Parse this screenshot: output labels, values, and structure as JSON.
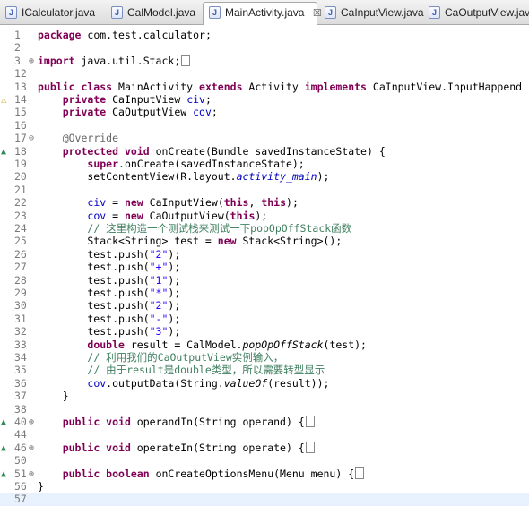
{
  "tabs": [
    {
      "label": "ICalculator.java",
      "active": false
    },
    {
      "label": "CalModel.java",
      "active": false
    },
    {
      "label": "MainActivity.java",
      "active": true,
      "close": "☒"
    },
    {
      "label": "CaInputView.java",
      "active": false
    },
    {
      "label": "CaOutputView.java",
      "active": false
    }
  ],
  "lines": [
    {
      "n": "1",
      "parts": [
        [
          "kw",
          "package"
        ],
        [
          "",
          "com.test.calculator;"
        ]
      ]
    },
    {
      "n": "2",
      "parts": []
    },
    {
      "n": "3",
      "fold": "⊕",
      "parts": [
        [
          "kw",
          "import"
        ],
        [
          "",
          "java.util.Stack;"
        ]
      ],
      "box": true
    },
    {
      "n": "12",
      "parts": []
    },
    {
      "n": "13",
      "parts": [
        [
          "kw",
          "public class"
        ],
        [
          "",
          " MainActivity "
        ],
        [
          "kw",
          "extends"
        ],
        [
          "",
          " Activity "
        ],
        [
          "kw",
          "implements"
        ],
        [
          "",
          " CaInputView.InputHappend {"
        ]
      ]
    },
    {
      "n": "14",
      "mark": "warn",
      "parts": [
        [
          "",
          "    "
        ],
        [
          "kw",
          "private"
        ],
        [
          "",
          " CaInputView "
        ],
        [
          "fld",
          "civ"
        ],
        [
          "",
          ";"
        ]
      ]
    },
    {
      "n": "15",
      "parts": [
        [
          "",
          "    "
        ],
        [
          "kw",
          "private"
        ],
        [
          "",
          " CaOutputView "
        ],
        [
          "fld",
          "cov"
        ],
        [
          "",
          ";"
        ]
      ]
    },
    {
      "n": "16",
      "parts": []
    },
    {
      "n": "17",
      "fold": "⊖",
      "parts": [
        [
          "",
          "    "
        ],
        [
          "ann",
          "@Override"
        ]
      ]
    },
    {
      "n": "18",
      "mark": "override",
      "parts": [
        [
          "",
          "    "
        ],
        [
          "kw",
          "protected void"
        ],
        [
          "",
          " onCreate(Bundle savedInstanceState) {"
        ]
      ]
    },
    {
      "n": "19",
      "parts": [
        [
          "",
          "        "
        ],
        [
          "kw",
          "super"
        ],
        [
          "",
          ".onCreate(savedInstanceState);"
        ]
      ]
    },
    {
      "n": "20",
      "parts": [
        [
          "",
          "        setContentView(R.layout."
        ],
        [
          "ifld",
          "activity_main"
        ],
        [
          "",
          ");"
        ]
      ]
    },
    {
      "n": "21",
      "parts": []
    },
    {
      "n": "22",
      "parts": [
        [
          "",
          "        "
        ],
        [
          "fld",
          "civ"
        ],
        [
          "",
          " = "
        ],
        [
          "kw",
          "new"
        ],
        [
          "",
          " CaInputView("
        ],
        [
          "kw",
          "this"
        ],
        [
          "",
          ", "
        ],
        [
          "kw",
          "this"
        ],
        [
          "",
          ");"
        ]
      ]
    },
    {
      "n": "23",
      "parts": [
        [
          "",
          "        "
        ],
        [
          "fld",
          "cov"
        ],
        [
          "",
          " = "
        ],
        [
          "kw",
          "new"
        ],
        [
          "",
          " CaOutputView("
        ],
        [
          "kw",
          "this"
        ],
        [
          "",
          ");"
        ]
      ]
    },
    {
      "n": "24",
      "parts": [
        [
          "",
          "        "
        ],
        [
          "cmt",
          "// 这里构造一个测试栈来测试一下popOpOffStack函数"
        ]
      ]
    },
    {
      "n": "25",
      "parts": [
        [
          "",
          "        Stack<String> test = "
        ],
        [
          "kw",
          "new"
        ],
        [
          "",
          " Stack<String>();"
        ]
      ]
    },
    {
      "n": "26",
      "parts": [
        [
          "",
          "        test.push("
        ],
        [
          "str",
          "\"2\""
        ],
        [
          "",
          ");"
        ]
      ]
    },
    {
      "n": "27",
      "parts": [
        [
          "",
          "        test.push("
        ],
        [
          "str",
          "\"+\""
        ],
        [
          "",
          ");"
        ]
      ]
    },
    {
      "n": "28",
      "parts": [
        [
          "",
          "        test.push("
        ],
        [
          "str",
          "\"1\""
        ],
        [
          "",
          ");"
        ]
      ]
    },
    {
      "n": "29",
      "parts": [
        [
          "",
          "        test.push("
        ],
        [
          "str",
          "\"*\""
        ],
        [
          "",
          ");"
        ]
      ]
    },
    {
      "n": "30",
      "parts": [
        [
          "",
          "        test.push("
        ],
        [
          "str",
          "\"2\""
        ],
        [
          "",
          ");"
        ]
      ]
    },
    {
      "n": "31",
      "parts": [
        [
          "",
          "        test.push("
        ],
        [
          "str",
          "\"-\""
        ],
        [
          "",
          ");"
        ]
      ]
    },
    {
      "n": "32",
      "parts": [
        [
          "",
          "        test.push("
        ],
        [
          "str",
          "\"3\""
        ],
        [
          "",
          ");"
        ]
      ]
    },
    {
      "n": "33",
      "parts": [
        [
          "",
          "        "
        ],
        [
          "kw",
          "double"
        ],
        [
          "",
          " result = CalModel."
        ],
        [
          "ital",
          "popOpOffStack"
        ],
        [
          "",
          "(test);"
        ]
      ]
    },
    {
      "n": "34",
      "parts": [
        [
          "",
          "        "
        ],
        [
          "cmt",
          "// 利用我们的CaOutputView实例输入，"
        ]
      ]
    },
    {
      "n": "35",
      "parts": [
        [
          "",
          "        "
        ],
        [
          "cmt",
          "// 由于result是double类型，所以需要转型显示"
        ]
      ]
    },
    {
      "n": "36",
      "parts": [
        [
          "",
          "        "
        ],
        [
          "fld",
          "cov"
        ],
        [
          "",
          ".outputData(String."
        ],
        [
          "ital",
          "valueOf"
        ],
        [
          "",
          "(result));"
        ]
      ]
    },
    {
      "n": "37",
      "parts": [
        [
          "",
          "    }"
        ]
      ]
    },
    {
      "n": "38",
      "parts": []
    },
    {
      "n": "40",
      "mark": "override",
      "fold": "⊕",
      "parts": [
        [
          "",
          "    "
        ],
        [
          "kw",
          "public void"
        ],
        [
          "",
          " operandIn(String operand) {"
        ]
      ],
      "box": true
    },
    {
      "n": "44",
      "parts": []
    },
    {
      "n": "46",
      "mark": "override",
      "fold": "⊕",
      "parts": [
        [
          "",
          "    "
        ],
        [
          "kw",
          "public void"
        ],
        [
          "",
          " operateIn(String operate) {"
        ]
      ],
      "box": true
    },
    {
      "n": "50",
      "parts": []
    },
    {
      "n": "51",
      "mark": "override",
      "fold": "⊕",
      "parts": [
        [
          "",
          "    "
        ],
        [
          "kw",
          "public boolean"
        ],
        [
          "",
          " onCreateOptionsMenu(Menu menu) {"
        ]
      ],
      "box": true
    },
    {
      "n": "56",
      "parts": [
        [
          "",
          "}"
        ]
      ]
    },
    {
      "n": "57",
      "current": true,
      "parts": []
    }
  ]
}
